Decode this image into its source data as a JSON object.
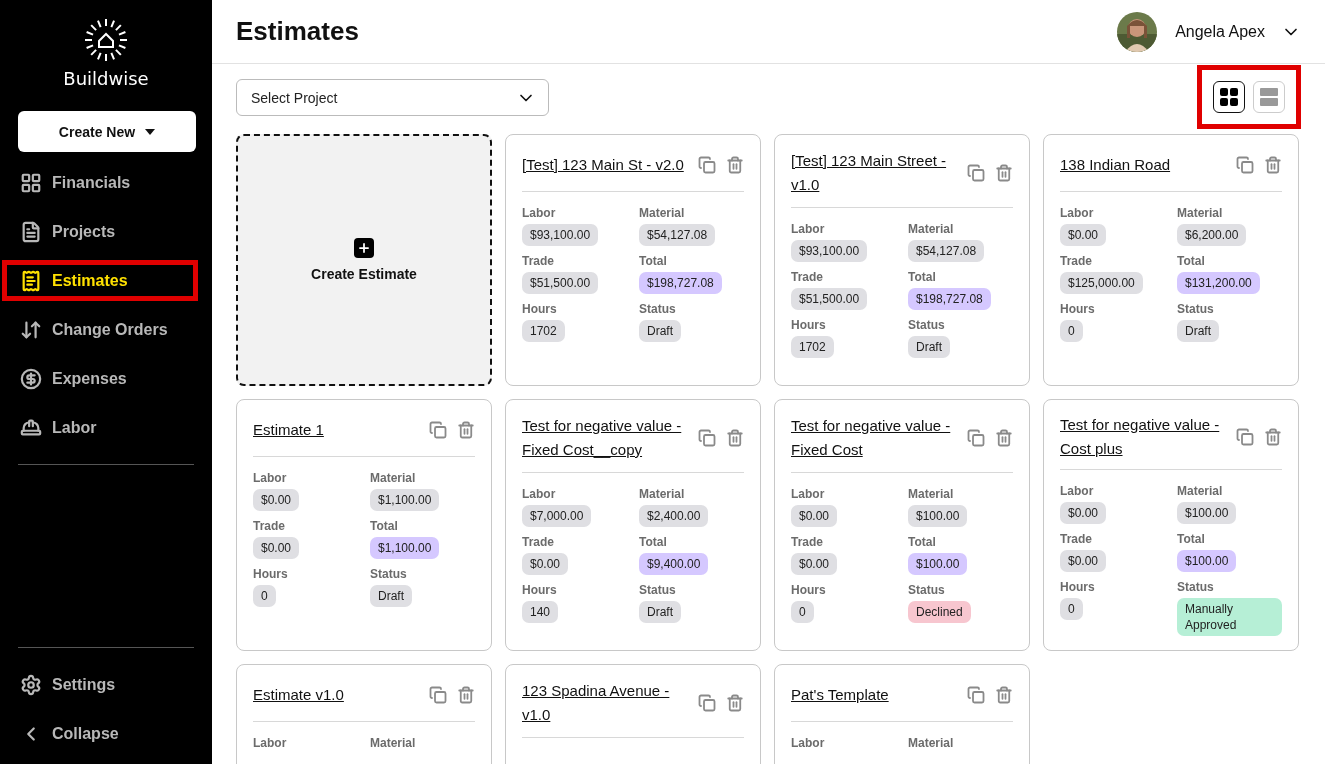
{
  "brand": {
    "name": "Buildwise"
  },
  "create_button": {
    "label": "Create New"
  },
  "nav": [
    {
      "label": "Financials",
      "selected": false,
      "highlighted": false
    },
    {
      "label": "Projects",
      "selected": false,
      "highlighted": false
    },
    {
      "label": "Estimates",
      "selected": true,
      "highlighted": true
    },
    {
      "label": "Change Orders",
      "selected": false,
      "highlighted": false
    },
    {
      "label": "Expenses",
      "selected": false,
      "highlighted": false
    },
    {
      "label": "Labor",
      "selected": false,
      "highlighted": false
    }
  ],
  "nav_bottom": [
    {
      "label": "Settings"
    },
    {
      "label": "Collapse"
    }
  ],
  "header": {
    "title": "Estimates",
    "user": "Angela Apex"
  },
  "project_select": {
    "placeholder": "Select Project"
  },
  "view_toggle": {
    "highlighted": true,
    "options": [
      {
        "selected": true
      },
      {
        "selected": false
      }
    ]
  },
  "create_card": {
    "label": "Create Estimate"
  },
  "cards": [
    {
      "title": "[Test] 123 Main St - v2.0",
      "fields": [
        {
          "label": "Labor",
          "value": "$93,100.00",
          "kind": "amount"
        },
        {
          "label": "Material",
          "value": "$54,127.08",
          "kind": "amount"
        },
        {
          "label": "Trade",
          "value": "$51,500.00",
          "kind": "amount"
        },
        {
          "label": "Total",
          "value": "$198,727.08",
          "kind": "total"
        },
        {
          "label": "Hours",
          "value": "1702",
          "kind": "amount"
        },
        {
          "label": "Status",
          "value": "Draft",
          "kind": "draft"
        }
      ]
    },
    {
      "title": "[Test] 123 Main Street - v1.0",
      "fields": [
        {
          "label": "Labor",
          "value": "$93,100.00",
          "kind": "amount"
        },
        {
          "label": "Material",
          "value": "$54,127.08",
          "kind": "amount"
        },
        {
          "label": "Trade",
          "value": "$51,500.00",
          "kind": "amount"
        },
        {
          "label": "Total",
          "value": "$198,727.08",
          "kind": "total"
        },
        {
          "label": "Hours",
          "value": "1702",
          "kind": "amount"
        },
        {
          "label": "Status",
          "value": "Draft",
          "kind": "draft"
        }
      ]
    },
    {
      "title": "138 Indian Road",
      "fields": [
        {
          "label": "Labor",
          "value": "$0.00",
          "kind": "amount"
        },
        {
          "label": "Material",
          "value": "$6,200.00",
          "kind": "amount"
        },
        {
          "label": "Trade",
          "value": "$125,000.00",
          "kind": "amount"
        },
        {
          "label": "Total",
          "value": "$131,200.00",
          "kind": "total"
        },
        {
          "label": "Hours",
          "value": "0",
          "kind": "amount"
        },
        {
          "label": "Status",
          "value": "Draft",
          "kind": "draft"
        }
      ]
    },
    {
      "title": "Estimate 1",
      "fields": [
        {
          "label": "Labor",
          "value": "$0.00",
          "kind": "amount"
        },
        {
          "label": "Material",
          "value": "$1,100.00",
          "kind": "amount"
        },
        {
          "label": "Trade",
          "value": "$0.00",
          "kind": "amount"
        },
        {
          "label": "Total",
          "value": "$1,100.00",
          "kind": "total"
        },
        {
          "label": "Hours",
          "value": "0",
          "kind": "amount"
        },
        {
          "label": "Status",
          "value": "Draft",
          "kind": "draft"
        }
      ]
    },
    {
      "title": "Test for negative value - Fixed Cost__copy",
      "fields": [
        {
          "label": "Labor",
          "value": "$7,000.00",
          "kind": "amount"
        },
        {
          "label": "Material",
          "value": "$2,400.00",
          "kind": "amount"
        },
        {
          "label": "Trade",
          "value": "$0.00",
          "kind": "amount"
        },
        {
          "label": "Total",
          "value": "$9,400.00",
          "kind": "total"
        },
        {
          "label": "Hours",
          "value": "140",
          "kind": "amount"
        },
        {
          "label": "Status",
          "value": "Draft",
          "kind": "draft"
        }
      ]
    },
    {
      "title": "Test for negative value - Fixed Cost",
      "fields": [
        {
          "label": "Labor",
          "value": "$0.00",
          "kind": "amount"
        },
        {
          "label": "Material",
          "value": "$100.00",
          "kind": "amount"
        },
        {
          "label": "Trade",
          "value": "$0.00",
          "kind": "amount"
        },
        {
          "label": "Total",
          "value": "$100.00",
          "kind": "total"
        },
        {
          "label": "Hours",
          "value": "0",
          "kind": "amount"
        },
        {
          "label": "Status",
          "value": "Declined",
          "kind": "declined"
        }
      ]
    },
    {
      "title": "Test for negative value - Cost plus",
      "fields": [
        {
          "label": "Labor",
          "value": "$0.00",
          "kind": "amount"
        },
        {
          "label": "Material",
          "value": "$100.00",
          "kind": "amount"
        },
        {
          "label": "Trade",
          "value": "$0.00",
          "kind": "amount"
        },
        {
          "label": "Total",
          "value": "$100.00",
          "kind": "total"
        },
        {
          "label": "Hours",
          "value": "0",
          "kind": "amount"
        },
        {
          "label": "Status",
          "value": "Manually Approved",
          "kind": "approved"
        }
      ]
    },
    {
      "title": "Estimate v1.0",
      "fields": [
        {
          "label": "Labor"
        },
        {
          "label": "Material"
        }
      ]
    },
    {
      "title": "123 Spadina Avenue - v1.0"
    },
    {
      "title": "Pat's Template",
      "fields": [
        {
          "label": "Labor"
        },
        {
          "label": "Material"
        }
      ]
    }
  ]
}
